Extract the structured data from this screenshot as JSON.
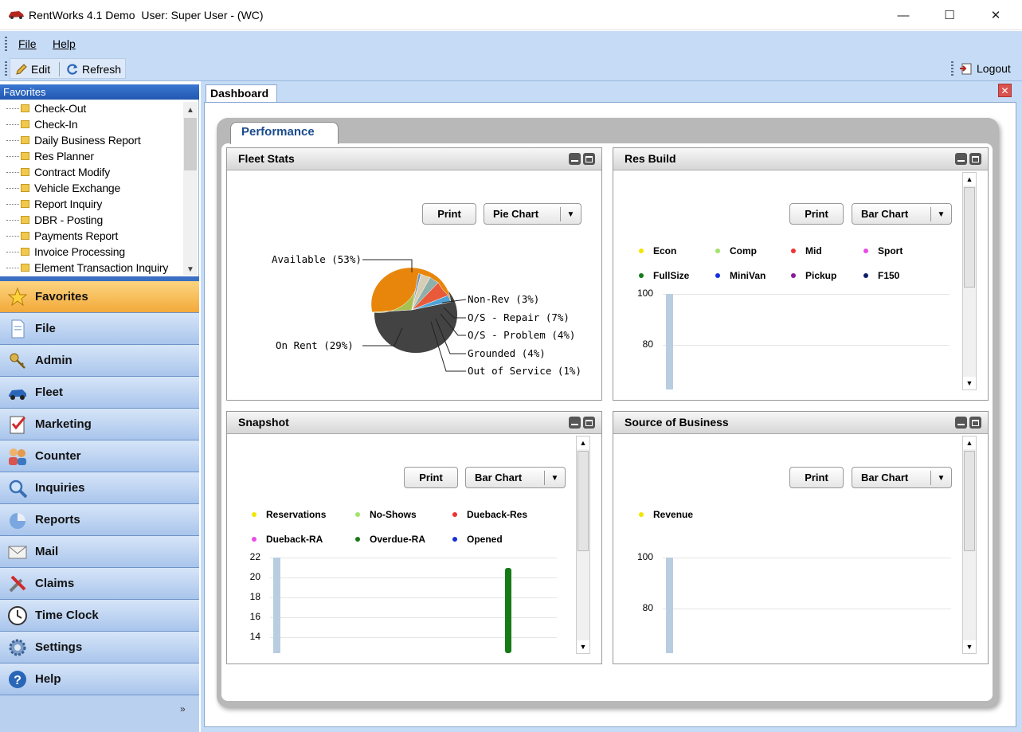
{
  "window": {
    "title": "RentWorks 4.1 Demo  User: Super User - (WC)",
    "minimize": "—",
    "maximize": "☐",
    "close": "✕"
  },
  "menu": {
    "file": "File",
    "help": "Help"
  },
  "toolbar": {
    "edit": "Edit",
    "refresh": "Refresh",
    "logout": "Logout"
  },
  "favorites": {
    "header": "Favorites",
    "items": [
      "Check-Out",
      "Check-In",
      "Daily Business Report",
      "Res Planner",
      "Contract Modify",
      "Vehicle Exchange",
      "Report Inquiry",
      "DBR - Posting",
      "Payments Report",
      "Invoice Processing",
      "Element Transaction Inquiry"
    ]
  },
  "nav": {
    "items": [
      {
        "label": "Favorites",
        "icon": "star-icon"
      },
      {
        "label": "File",
        "icon": "document-icon"
      },
      {
        "label": "Admin",
        "icon": "keys-icon"
      },
      {
        "label": "Fleet",
        "icon": "car-icon"
      },
      {
        "label": "Marketing",
        "icon": "checklist-icon"
      },
      {
        "label": "Counter",
        "icon": "people-icon"
      },
      {
        "label": "Inquiries",
        "icon": "magnifier-icon"
      },
      {
        "label": "Reports",
        "icon": "pie-icon"
      },
      {
        "label": "Mail",
        "icon": "envelope-icon"
      },
      {
        "label": "Claims",
        "icon": "tools-icon"
      },
      {
        "label": "Time Clock",
        "icon": "clock-icon"
      },
      {
        "label": "Settings",
        "icon": "gear-icon"
      },
      {
        "label": "Help",
        "icon": "help-icon"
      }
    ],
    "more": "»"
  },
  "dashboard": {
    "tab": "Dashboard",
    "close": "✕",
    "subtab": "Performance",
    "print": "Print"
  },
  "panels": {
    "fleet_stats": {
      "title": "Fleet Stats",
      "chart_type": "Pie Chart"
    },
    "res_build": {
      "title": "Res Build",
      "chart_type": "Bar Chart"
    },
    "snapshot": {
      "title": "Snapshot",
      "chart_type": "Bar Chart"
    },
    "source_of_business": {
      "title": "Source of Business",
      "chart_type": "Bar Chart"
    }
  },
  "colors": {
    "accent": "#2257b0",
    "nav_active": "#f3a93a"
  },
  "chart_data": [
    {
      "panel": "Fleet Stats",
      "type": "pie",
      "slices": [
        {
          "label": "Available (53%)",
          "value": 53,
          "color": "#e8860c"
        },
        {
          "label": "On Rent (29%)",
          "value": 29,
          "color": "#a8c150"
        },
        {
          "label": "Out of Service (1%)",
          "value": 1,
          "color": "#6a8fc4"
        },
        {
          "label": "Grounded (4%)",
          "value": 4,
          "color": "#d6ceb4"
        },
        {
          "label": "O/S - Problem (4%)",
          "value": 4,
          "color": "#8fb0aa"
        },
        {
          "label": "O/S - Repair (7%)",
          "value": 7,
          "color": "#e85a3a"
        },
        {
          "label": "Non-Rev (3%)",
          "value": 3,
          "color": "#4fa3d8"
        }
      ]
    },
    {
      "panel": "Res Build",
      "type": "bar",
      "legend": [
        {
          "name": "Econ",
          "color": "#f2e500"
        },
        {
          "name": "Comp",
          "color": "#a3e36a"
        },
        {
          "name": "Mid",
          "color": "#ee3333"
        },
        {
          "name": "Sport",
          "color": "#e84be8"
        },
        {
          "name": "FullSize",
          "color": "#167a16"
        },
        {
          "name": "MiniVan",
          "color": "#1530e0"
        },
        {
          "name": "Pickup",
          "color": "#8a1a9a"
        },
        {
          "name": "F150",
          "color": "#0e1d6b"
        }
      ],
      "y_ticks": [
        "100",
        "80"
      ]
    },
    {
      "panel": "Snapshot",
      "type": "bar",
      "legend": [
        {
          "name": "Reservations",
          "color": "#f2e500"
        },
        {
          "name": "No-Shows",
          "color": "#a3e36a"
        },
        {
          "name": "Dueback-Res",
          "color": "#ee3333"
        },
        {
          "name": "Dueback-RA",
          "color": "#e84be8"
        },
        {
          "name": "Overdue-RA",
          "color": "#167a16"
        },
        {
          "name": "Opened",
          "color": "#1530e0"
        }
      ],
      "y_ticks": [
        "22",
        "20",
        "18",
        "16",
        "14"
      ],
      "series": [
        {
          "name": "Overdue-RA",
          "values": [
            21
          ]
        }
      ]
    },
    {
      "panel": "Source of Business",
      "type": "bar",
      "legend": [
        {
          "name": "Revenue",
          "color": "#f2e500"
        }
      ],
      "y_ticks": [
        "100",
        "80"
      ]
    }
  ]
}
